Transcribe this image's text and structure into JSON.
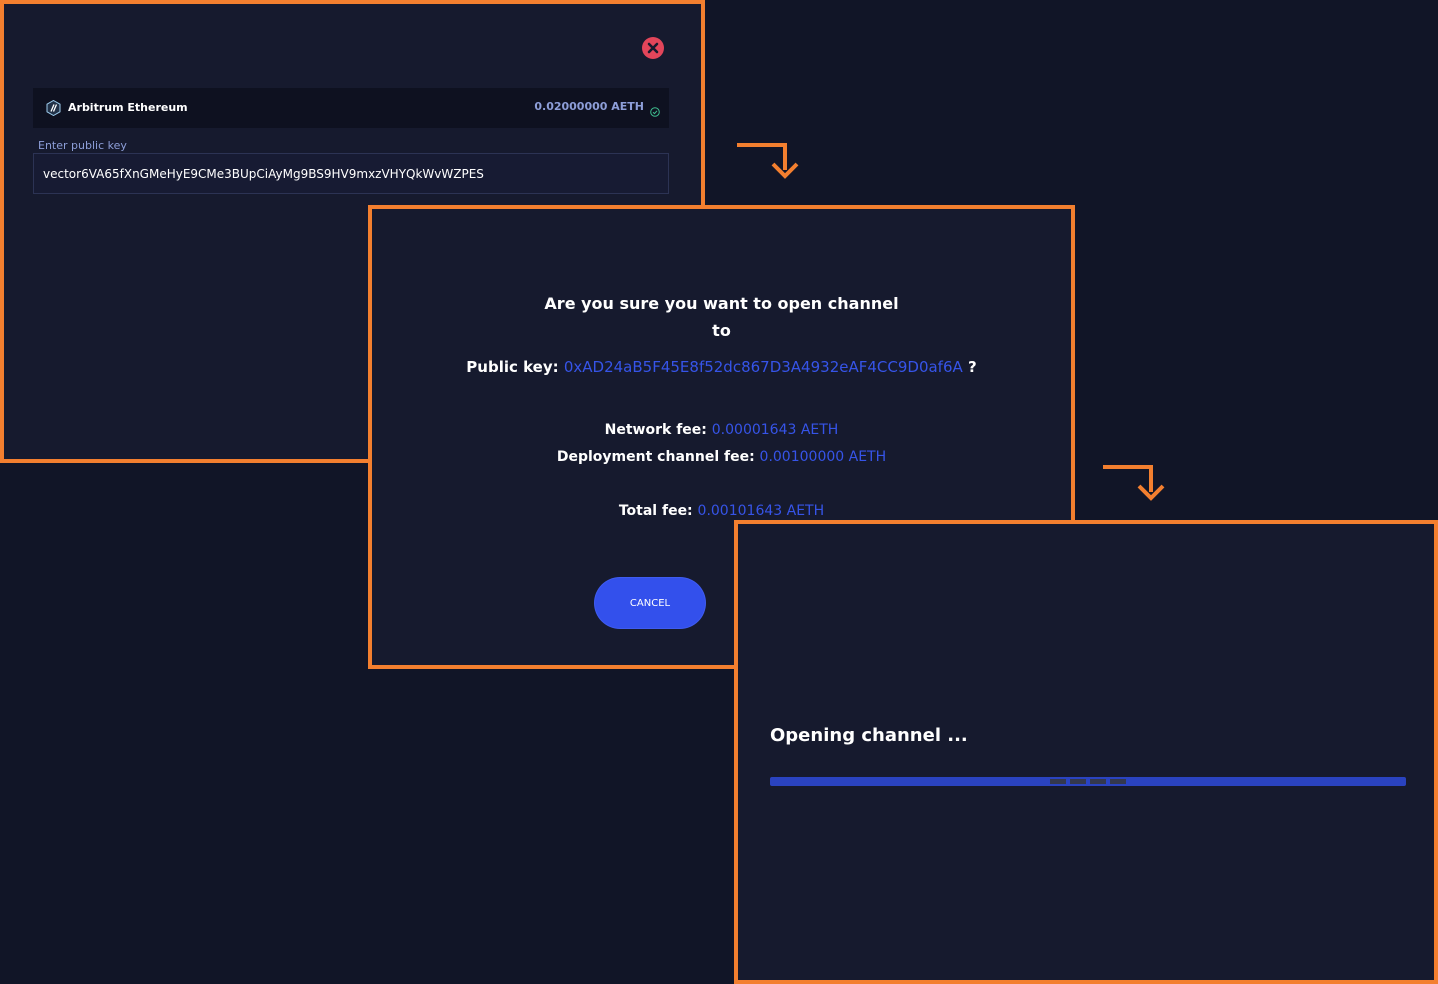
{
  "colors": {
    "accent_border": "#f37f2f",
    "panel_bg": "#161a2e",
    "page_bg": "#111527",
    "link_blue": "#3654e8",
    "button_blue": "#3350ec",
    "close_red": "#e2455a"
  },
  "step1": {
    "close_icon": "close-circle-icon",
    "network": {
      "icon": "arbitrum-logo-icon",
      "name": "Arbitrum Ethereum",
      "balance": "0.02000000 AETH",
      "status_icon": "check-circle-icon"
    },
    "public_key_label": "Enter public key",
    "public_key_value": "vector6VA65fXnGMeHyE9CMe3BUpCiAyMg9BS9HV9mxzVHYQkWvWZPES"
  },
  "step2": {
    "title_line1": "Are you sure you want to open channel",
    "title_line2": "to",
    "public_key_label": "Public key:",
    "public_key": "0xAD24aB5F45E8f52dc867D3A4932eAF4CC9D0af6A",
    "question_mark": "?",
    "network_fee_label": "Network fee:",
    "network_fee": "0.00001643 AETH",
    "deployment_fee_label": "Deployment channel fee:",
    "deployment_fee": "0.00100000 AETH",
    "total_fee_label": "Total fee:",
    "total_fee": "0.00101643 AETH",
    "cancel_label": "CANCEL"
  },
  "step3": {
    "status_text": "Opening channel ..."
  },
  "arrows": [
    "arrow-down-right-icon",
    "arrow-down-right-icon"
  ]
}
